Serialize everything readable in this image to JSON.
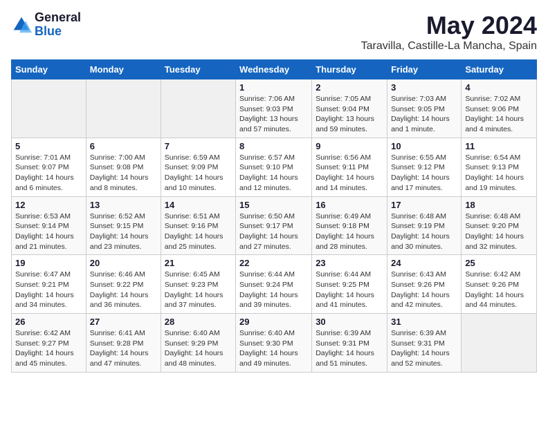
{
  "logo": {
    "general": "General",
    "blue": "Blue"
  },
  "title": "May 2024",
  "location": "Taravilla, Castille-La Mancha, Spain",
  "headers": [
    "Sunday",
    "Monday",
    "Tuesday",
    "Wednesday",
    "Thursday",
    "Friday",
    "Saturday"
  ],
  "weeks": [
    [
      {
        "day": "",
        "info": ""
      },
      {
        "day": "",
        "info": ""
      },
      {
        "day": "",
        "info": ""
      },
      {
        "day": "1",
        "info": "Sunrise: 7:06 AM\nSunset: 9:03 PM\nDaylight: 13 hours and 57 minutes."
      },
      {
        "day": "2",
        "info": "Sunrise: 7:05 AM\nSunset: 9:04 PM\nDaylight: 13 hours and 59 minutes."
      },
      {
        "day": "3",
        "info": "Sunrise: 7:03 AM\nSunset: 9:05 PM\nDaylight: 14 hours and 1 minute."
      },
      {
        "day": "4",
        "info": "Sunrise: 7:02 AM\nSunset: 9:06 PM\nDaylight: 14 hours and 4 minutes."
      }
    ],
    [
      {
        "day": "5",
        "info": "Sunrise: 7:01 AM\nSunset: 9:07 PM\nDaylight: 14 hours and 6 minutes."
      },
      {
        "day": "6",
        "info": "Sunrise: 7:00 AM\nSunset: 9:08 PM\nDaylight: 14 hours and 8 minutes."
      },
      {
        "day": "7",
        "info": "Sunrise: 6:59 AM\nSunset: 9:09 PM\nDaylight: 14 hours and 10 minutes."
      },
      {
        "day": "8",
        "info": "Sunrise: 6:57 AM\nSunset: 9:10 PM\nDaylight: 14 hours and 12 minutes."
      },
      {
        "day": "9",
        "info": "Sunrise: 6:56 AM\nSunset: 9:11 PM\nDaylight: 14 hours and 14 minutes."
      },
      {
        "day": "10",
        "info": "Sunrise: 6:55 AM\nSunset: 9:12 PM\nDaylight: 14 hours and 17 minutes."
      },
      {
        "day": "11",
        "info": "Sunrise: 6:54 AM\nSunset: 9:13 PM\nDaylight: 14 hours and 19 minutes."
      }
    ],
    [
      {
        "day": "12",
        "info": "Sunrise: 6:53 AM\nSunset: 9:14 PM\nDaylight: 14 hours and 21 minutes."
      },
      {
        "day": "13",
        "info": "Sunrise: 6:52 AM\nSunset: 9:15 PM\nDaylight: 14 hours and 23 minutes."
      },
      {
        "day": "14",
        "info": "Sunrise: 6:51 AM\nSunset: 9:16 PM\nDaylight: 14 hours and 25 minutes."
      },
      {
        "day": "15",
        "info": "Sunrise: 6:50 AM\nSunset: 9:17 PM\nDaylight: 14 hours and 27 minutes."
      },
      {
        "day": "16",
        "info": "Sunrise: 6:49 AM\nSunset: 9:18 PM\nDaylight: 14 hours and 28 minutes."
      },
      {
        "day": "17",
        "info": "Sunrise: 6:48 AM\nSunset: 9:19 PM\nDaylight: 14 hours and 30 minutes."
      },
      {
        "day": "18",
        "info": "Sunrise: 6:48 AM\nSunset: 9:20 PM\nDaylight: 14 hours and 32 minutes."
      }
    ],
    [
      {
        "day": "19",
        "info": "Sunrise: 6:47 AM\nSunset: 9:21 PM\nDaylight: 14 hours and 34 minutes."
      },
      {
        "day": "20",
        "info": "Sunrise: 6:46 AM\nSunset: 9:22 PM\nDaylight: 14 hours and 36 minutes."
      },
      {
        "day": "21",
        "info": "Sunrise: 6:45 AM\nSunset: 9:23 PM\nDaylight: 14 hours and 37 minutes."
      },
      {
        "day": "22",
        "info": "Sunrise: 6:44 AM\nSunset: 9:24 PM\nDaylight: 14 hours and 39 minutes."
      },
      {
        "day": "23",
        "info": "Sunrise: 6:44 AM\nSunset: 9:25 PM\nDaylight: 14 hours and 41 minutes."
      },
      {
        "day": "24",
        "info": "Sunrise: 6:43 AM\nSunset: 9:26 PM\nDaylight: 14 hours and 42 minutes."
      },
      {
        "day": "25",
        "info": "Sunrise: 6:42 AM\nSunset: 9:26 PM\nDaylight: 14 hours and 44 minutes."
      }
    ],
    [
      {
        "day": "26",
        "info": "Sunrise: 6:42 AM\nSunset: 9:27 PM\nDaylight: 14 hours and 45 minutes."
      },
      {
        "day": "27",
        "info": "Sunrise: 6:41 AM\nSunset: 9:28 PM\nDaylight: 14 hours and 47 minutes."
      },
      {
        "day": "28",
        "info": "Sunrise: 6:40 AM\nSunset: 9:29 PM\nDaylight: 14 hours and 48 minutes."
      },
      {
        "day": "29",
        "info": "Sunrise: 6:40 AM\nSunset: 9:30 PM\nDaylight: 14 hours and 49 minutes."
      },
      {
        "day": "30",
        "info": "Sunrise: 6:39 AM\nSunset: 9:31 PM\nDaylight: 14 hours and 51 minutes."
      },
      {
        "day": "31",
        "info": "Sunrise: 6:39 AM\nSunset: 9:31 PM\nDaylight: 14 hours and 52 minutes."
      },
      {
        "day": "",
        "info": ""
      }
    ]
  ]
}
